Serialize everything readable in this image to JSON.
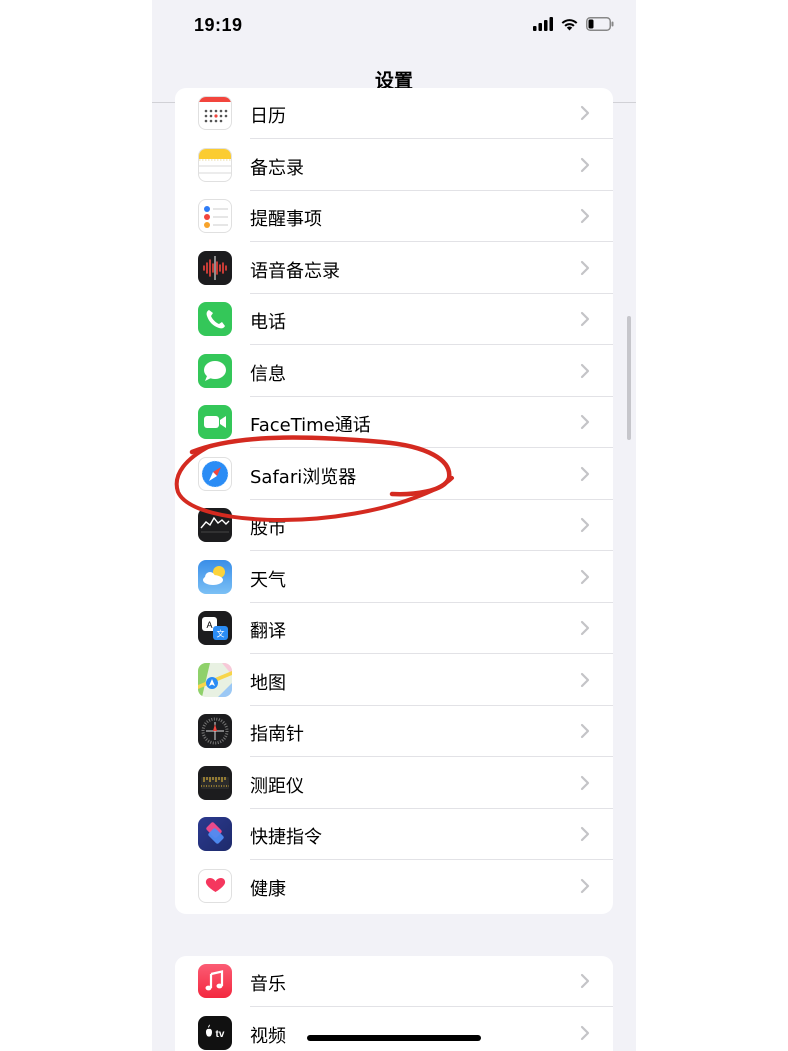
{
  "status_bar": {
    "time": "19:19"
  },
  "nav": {
    "title": "设置"
  },
  "group1": {
    "items": [
      {
        "label": "日历",
        "icon": "calendar-icon"
      },
      {
        "label": "备忘录",
        "icon": "notes-icon"
      },
      {
        "label": "提醒事项",
        "icon": "reminders-icon"
      },
      {
        "label": "语音备忘录",
        "icon": "voice-memos-icon"
      },
      {
        "label": "电话",
        "icon": "phone-icon"
      },
      {
        "label": "信息",
        "icon": "messages-icon"
      },
      {
        "label": "FaceTime通话",
        "icon": "facetime-icon"
      },
      {
        "label": "Safari浏览器",
        "icon": "safari-icon"
      },
      {
        "label": "股市",
        "icon": "stocks-icon"
      },
      {
        "label": "天气",
        "icon": "weather-icon"
      },
      {
        "label": "翻译",
        "icon": "translate-icon"
      },
      {
        "label": "地图",
        "icon": "maps-icon"
      },
      {
        "label": "指南针",
        "icon": "compass-icon"
      },
      {
        "label": "测距仪",
        "icon": "measure-icon"
      },
      {
        "label": "快捷指令",
        "icon": "shortcuts-icon"
      },
      {
        "label": "健康",
        "icon": "health-icon"
      }
    ]
  },
  "group2": {
    "items": [
      {
        "label": "音乐",
        "icon": "music-icon"
      },
      {
        "label": "视频",
        "icon": "tv-icon"
      }
    ]
  },
  "tv_icon_text": "tv",
  "annotation": {
    "color": "#d42a20",
    "highlighted_item": "Safari浏览器"
  }
}
